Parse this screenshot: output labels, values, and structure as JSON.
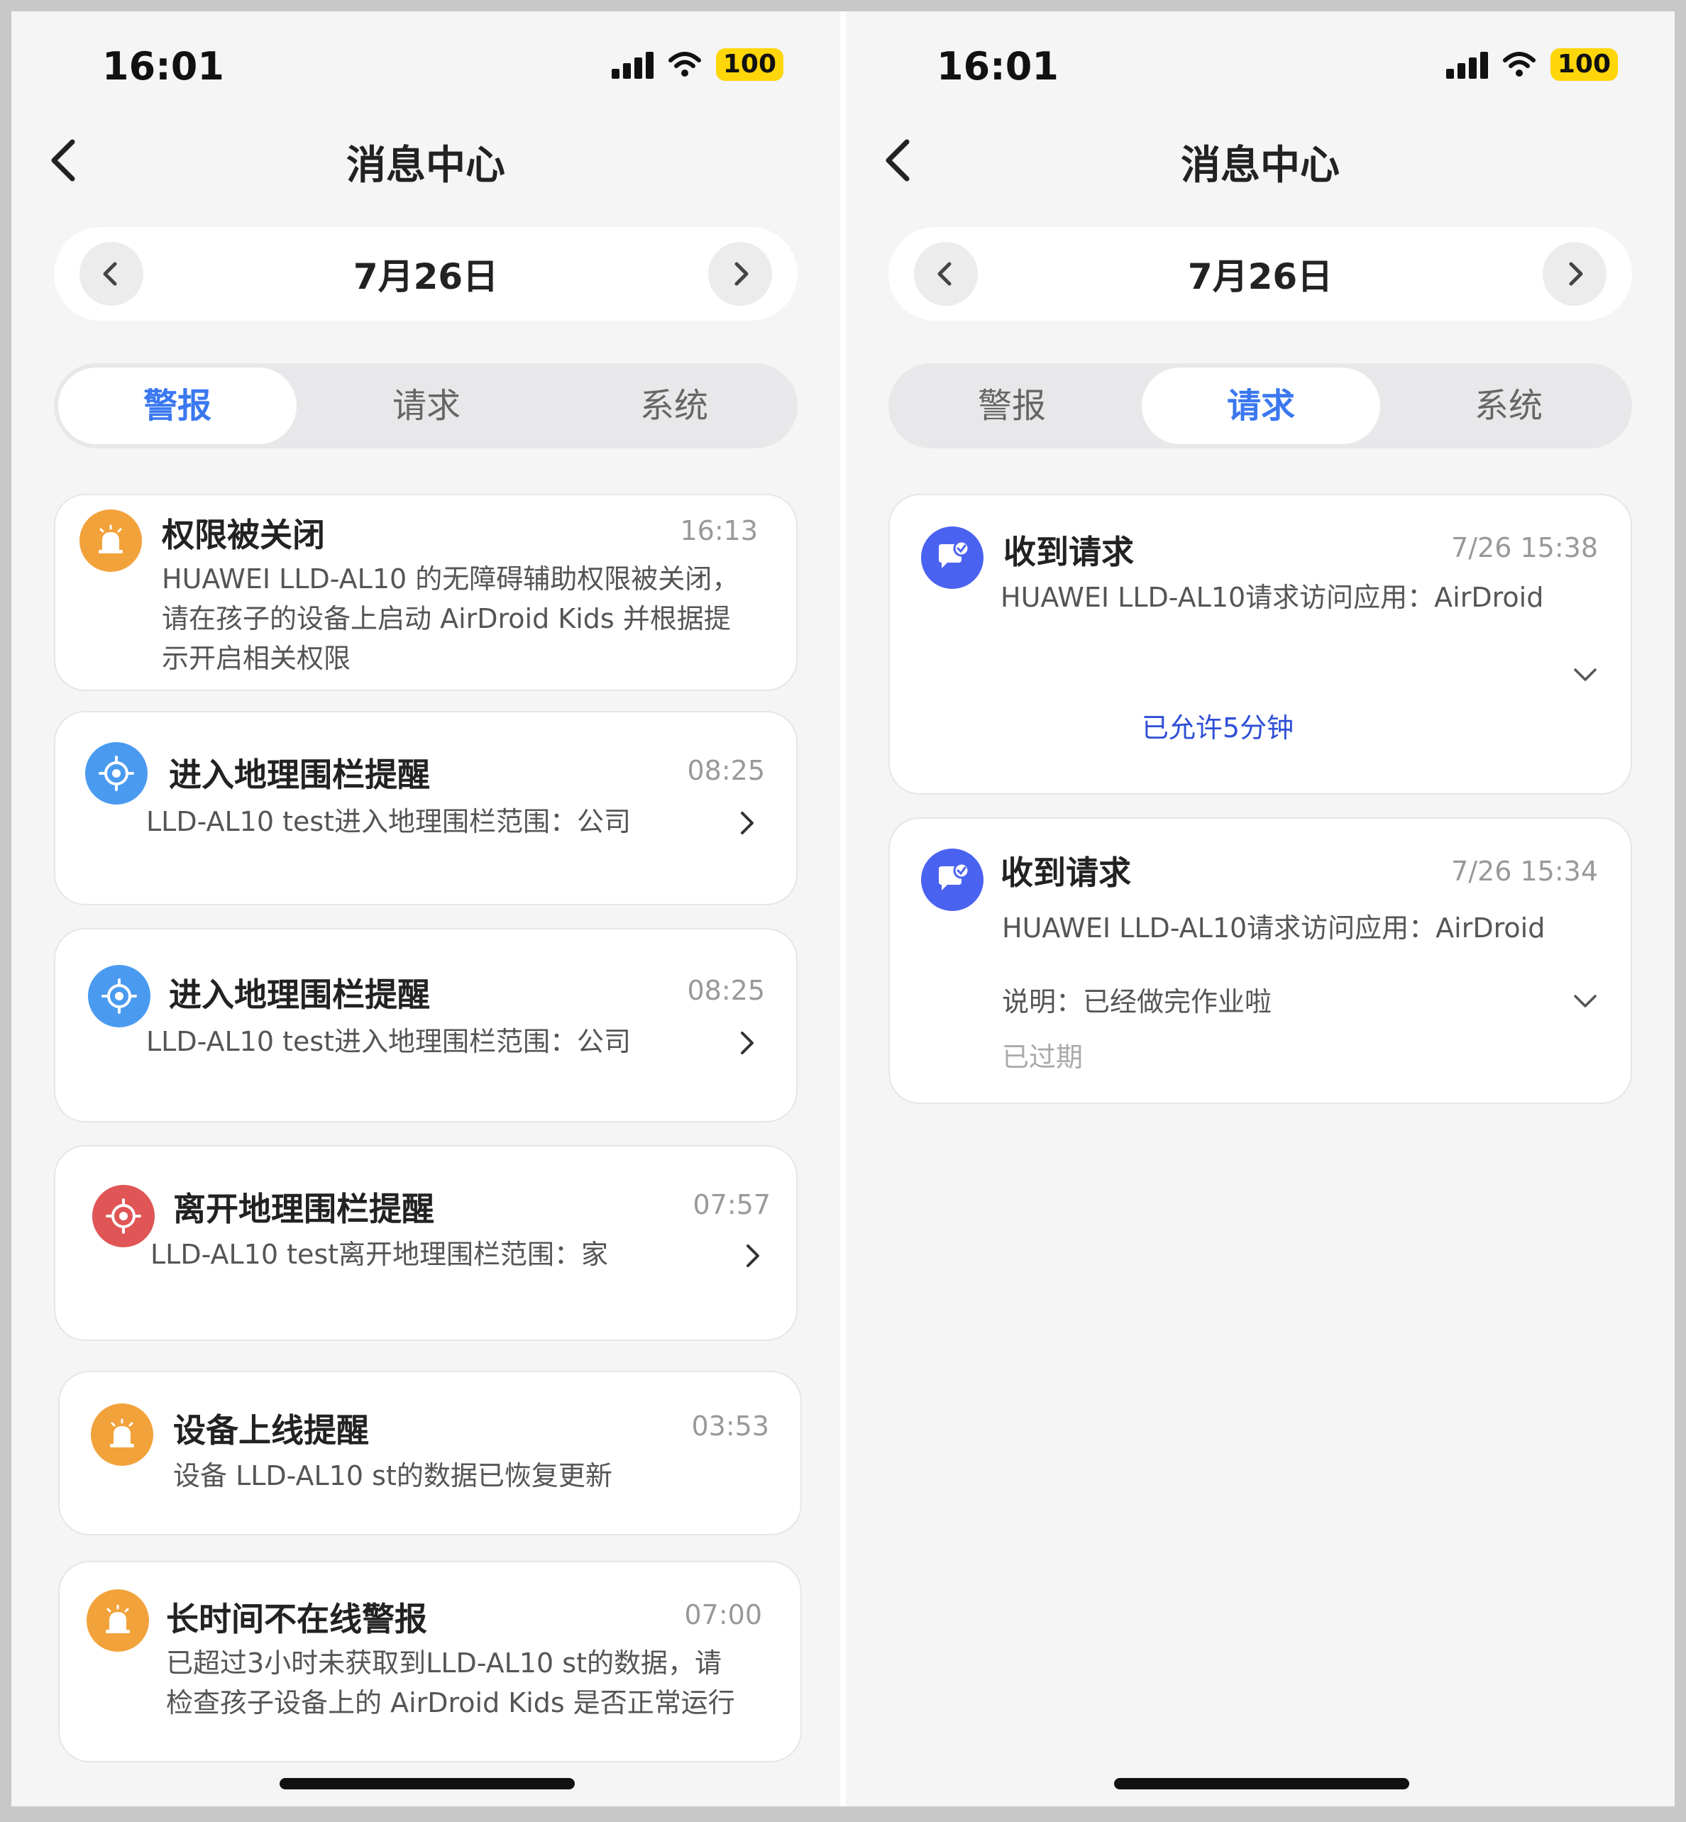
{
  "left": {
    "status": {
      "time": "16:01",
      "battery": "100"
    },
    "nav": {
      "title": "消息中心"
    },
    "date": {
      "label": "7月26日"
    },
    "tabs": [
      {
        "label": "警报"
      },
      {
        "label": "请求"
      },
      {
        "label": "系统"
      }
    ],
    "cards": [
      {
        "icon": "alarm-icon",
        "title": "权限被关闭",
        "time": "16:13",
        "body": [
          "HUAWEI LLD-AL10 的无障碍辅助权限被关闭，",
          "请在孩子的设备上启动 AirDroid Kids 并根据提",
          "示开启相关权限"
        ]
      },
      {
        "icon": "geofence-icon",
        "title": "进入地理围栏提醒",
        "time": "08:25",
        "body": [
          "LLD-AL10 test进入地理围栏范围：公司"
        ]
      },
      {
        "icon": "geofence-icon",
        "title": "进入地理围栏提醒",
        "time": "08:25",
        "body": [
          "LLD-AL10 test进入地理围栏范围：公司"
        ]
      },
      {
        "icon": "geofence-icon",
        "title": "离开地理围栏提醒",
        "time": "07:57",
        "body": [
          "LLD-AL10 test离开地理围栏范围：家"
        ]
      },
      {
        "icon": "alarm-icon",
        "title": "设备上线提醒",
        "time": "03:53",
        "body": [
          "设备 LLD-AL10 st的数据已恢复更新"
        ]
      },
      {
        "icon": "alarm-icon",
        "title": "长时间不在线警报",
        "time": "07:00",
        "body": [
          "已超过3小时未获取到LLD-AL10 st的数据，请",
          "检查孩子设备上的 AirDroid Kids 是否正常运行"
        ]
      }
    ]
  },
  "right": {
    "status": {
      "time": "16:01",
      "battery": "100"
    },
    "nav": {
      "title": "消息中心"
    },
    "date": {
      "label": "7月26日"
    },
    "tabs": [
      {
        "label": "警报"
      },
      {
        "label": "请求"
      },
      {
        "label": "系统"
      }
    ],
    "cards": [
      {
        "icon": "request-icon",
        "title": "收到请求",
        "time": "7/26 15:38",
        "body": "HUAWEI LLD-AL10请求访问应用：AirDroid",
        "status": "已允许5分钟"
      },
      {
        "icon": "request-icon",
        "title": "收到请求",
        "time": "7/26 15:34",
        "body": "HUAWEI LLD-AL10请求访问应用：AirDroid",
        "note": "说明：已经做完作业啦",
        "status": "已过期"
      }
    ]
  },
  "colors": {
    "accent": "#3b78f0",
    "alarm": "#f2a23a",
    "geofence_enter": "#4a9af0",
    "geofence_leave": "#e05555",
    "request": "#4a62f0",
    "allowed_text": "#2f4fd6",
    "expired_text": "#aaaaaa"
  }
}
